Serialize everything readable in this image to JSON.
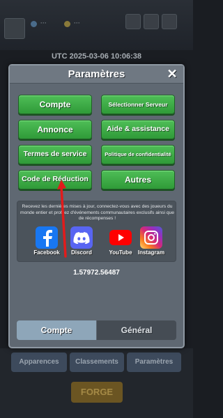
{
  "background": {
    "utc_label": "UTC 2025-03-06 10:06:38",
    "nav": [
      "Apparences",
      "Classements",
      "Paramètres"
    ],
    "forge_label": "FORGE"
  },
  "dialog": {
    "title": "Paramètres",
    "buttons": {
      "compte": "Compte",
      "selectionner_serveur": "Sélectionner Serveur",
      "annonce": "Annonce",
      "aide": "Aide & assistance",
      "termes": "Termes de service",
      "politique": "Politique de confidentialité",
      "code": "Code de Réduction",
      "autres": "Autres"
    },
    "social": {
      "text": "Recevez les dernières mises à jour, connectez-vous avec des joueurs du monde entier et profitez d'événements communautaires exclusifs ainsi que de récompenses !",
      "items": [
        "Facebook",
        "Discord",
        "YouTube",
        "Instagram"
      ]
    },
    "version": "1.57972.56487",
    "tabs": {
      "active": "Compte",
      "inactive": "Général"
    }
  },
  "colors": {
    "button_green": "#3fae48",
    "arrow_red": "#e21b1b",
    "facebook": "#1877f2",
    "discord": "#5865f2",
    "youtube": "#ff0000"
  }
}
